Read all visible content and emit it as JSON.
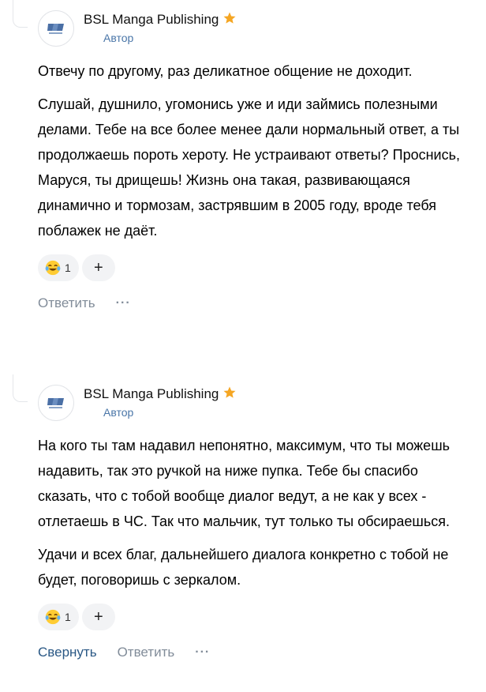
{
  "comments": [
    {
      "author": "BSL Manga Publishing",
      "badge": "Автор",
      "paragraphs": [
        "Отвечу по другому, раз деликатное общение не доходит.",
        "Слушай, душнило, угомонись уже и иди займись полезными делами. Тебе на все более менее дали нормальный ответ, а ты продолжаешь пороть хероту. Не устраивают ответы? Проснись, Маруся, ты дрищешь! Жизнь она такая, развивающаяся динамично и тормозам, застрявшим в 2005 году, вроде тебя поблажек не даёт."
      ],
      "reaction": {
        "emoji": "tears-of-joy-emoji",
        "count": "1"
      },
      "add_reaction_label": "+",
      "reply_label": "Ответить",
      "more_label": "···"
    },
    {
      "author": "BSL Manga Publishing",
      "badge": "Автор",
      "paragraphs": [
        "На кого ты там надавил непонятно, максимум, что ты можешь надавить, так это ручкой на ниже пупка. Тебе бы спасибо сказать, что с тобой вообще диалог ведут, а не как у всех - отлетаешь в ЧС. Так что мальчик, тут только ты обсираешься.",
        "Удачи и всех благ, дальнейшего диалога конкретно с тобой не будет, поговоришь с зеркалом."
      ],
      "reaction": {
        "emoji": "tears-of-joy-emoji",
        "count": "1"
      },
      "add_reaction_label": "+",
      "collapse_label": "Свернуть",
      "reply_label": "Ответить",
      "more_label": "···"
    }
  ],
  "colors": {
    "accent": "#2a5885",
    "badge": "#4a76a8",
    "muted": "#818c99",
    "star": "#f5a623",
    "pill_bg": "#f2f3f5"
  }
}
